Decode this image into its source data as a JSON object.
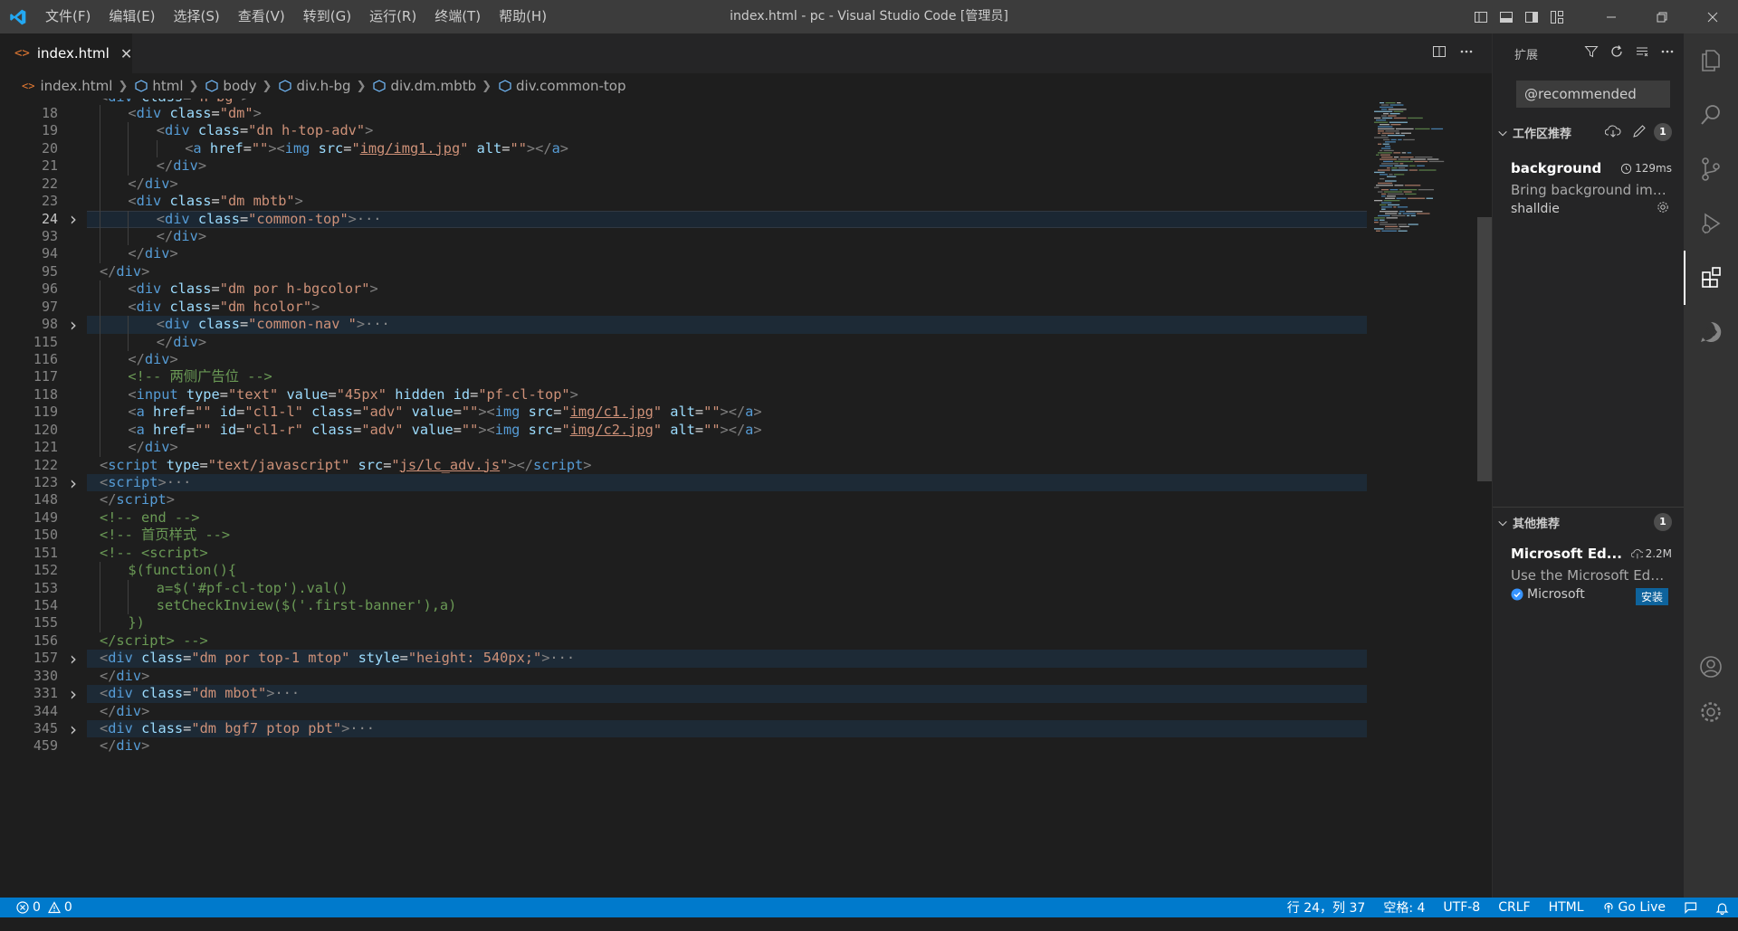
{
  "window": {
    "title": "index.html - pc - Visual Studio Code [管理员]"
  },
  "menu": [
    "文件(F)",
    "编辑(E)",
    "选择(S)",
    "查看(V)",
    "转到(G)",
    "运行(R)",
    "终端(T)",
    "帮助(H)"
  ],
  "tab": {
    "icon": "<>",
    "label": "index.html",
    "close": "✕"
  },
  "breadcrumb": [
    "index.html",
    "html",
    "body",
    "div.h-bg",
    "div.dm.mbtb",
    "div.common-top"
  ],
  "editor": {
    "partial_top_line": "<div class=\"h-bg\">",
    "cursor_line": 24,
    "lines": [
      {
        "n": "18",
        "indent": 2,
        "fold": false,
        "html": "<span class=\"t-tag\">&lt;</span><span class=\"t-name\">div</span> <span class=\"t-attr\">class</span><span class=\"t-txt\">=</span><span class=\"t-str\">\"dm\"</span><span class=\"t-tag\">&gt;</span>"
      },
      {
        "n": "19",
        "indent": 3,
        "fold": false,
        "html": "<span class=\"t-tag\">&lt;</span><span class=\"t-name\">div</span> <span class=\"t-attr\">class</span><span class=\"t-txt\">=</span><span class=\"t-str\">\"dn h-top-adv\"</span><span class=\"t-tag\">&gt;</span>"
      },
      {
        "n": "20",
        "indent": 4,
        "fold": false,
        "html": "<span class=\"t-tag\">&lt;</span><span class=\"t-name\">a</span> <span class=\"t-attr\">href</span><span class=\"t-txt\">=</span><span class=\"t-str\">\"\"</span><span class=\"t-tag\">&gt;&lt;</span><span class=\"t-name\">img</span> <span class=\"t-attr\">src</span><span class=\"t-txt\">=</span><span class=\"t-str\">\"</span><span class=\"t-link\">img/img1.jpg</span><span class=\"t-str\">\"</span> <span class=\"t-attr\">alt</span><span class=\"t-txt\">=</span><span class=\"t-str\">\"\"</span><span class=\"t-tag\">&gt;&lt;/</span><span class=\"t-name\">a</span><span class=\"t-tag\">&gt;</span>"
      },
      {
        "n": "21",
        "indent": 3,
        "fold": false,
        "html": "<span class=\"t-tag\">&lt;/</span><span class=\"t-name\">div</span><span class=\"t-tag\">&gt;</span>"
      },
      {
        "n": "22",
        "indent": 2,
        "fold": false,
        "html": "<span class=\"t-tag\">&lt;/</span><span class=\"t-name\">div</span><span class=\"t-tag\">&gt;</span>"
      },
      {
        "n": "23",
        "indent": 2,
        "fold": false,
        "html": "<span class=\"t-tag\">&lt;</span><span class=\"t-name\">div</span> <span class=\"t-attr\">class</span><span class=\"t-txt\">=</span><span class=\"t-str\">\"dm mbtb\"</span><span class=\"t-tag\">&gt;</span>"
      },
      {
        "n": "24",
        "indent": 3,
        "fold": true,
        "html": "<span class=\"t-tag\">&lt;</span><span class=\"t-name\">div</span> <span class=\"t-attr\">class</span><span class=\"t-txt\">=</span><span class=\"t-str\">\"common-top\"</span><span class=\"t-tag\">&gt;</span><span class=\"t-ell\">···</span>"
      },
      {
        "n": "93",
        "indent": 3,
        "fold": false,
        "html": "<span class=\"t-tag\">&lt;/</span><span class=\"t-name\">div</span><span class=\"t-tag\">&gt;</span>"
      },
      {
        "n": "94",
        "indent": 2,
        "fold": false,
        "html": "<span class=\"t-tag\">&lt;/</span><span class=\"t-name\">div</span><span class=\"t-tag\">&gt;</span>"
      },
      {
        "n": "95",
        "indent": 1,
        "fold": false,
        "html": "<span class=\"t-tag\">&lt;/</span><span class=\"t-name\">div</span><span class=\"t-tag\">&gt;</span>"
      },
      {
        "n": "96",
        "indent": 2,
        "fold": false,
        "html": "<span class=\"t-tag\">&lt;</span><span class=\"t-name\">div</span> <span class=\"t-attr\">class</span><span class=\"t-txt\">=</span><span class=\"t-str\">\"dm por h-bgcolor\"</span><span class=\"t-tag\">&gt;</span>"
      },
      {
        "n": "97",
        "indent": 2,
        "fold": false,
        "html": "<span class=\"t-tag\">&lt;</span><span class=\"t-name\">div</span> <span class=\"t-attr\">class</span><span class=\"t-txt\">=</span><span class=\"t-str\">\"dm hcolor\"</span><span class=\"t-tag\">&gt;</span>"
      },
      {
        "n": "98",
        "indent": 3,
        "fold": true,
        "html": "<span class=\"t-tag\">&lt;</span><span class=\"t-name\">div</span> <span class=\"t-attr\">class</span><span class=\"t-txt\">=</span><span class=\"t-str\">\"common-nav \"</span><span class=\"t-tag\">&gt;</span><span class=\"t-ell\">···</span>"
      },
      {
        "n": "115",
        "indent": 3,
        "fold": false,
        "html": "<span class=\"t-tag\">&lt;/</span><span class=\"t-name\">div</span><span class=\"t-tag\">&gt;</span>"
      },
      {
        "n": "116",
        "indent": 2,
        "fold": false,
        "html": "<span class=\"t-tag\">&lt;/</span><span class=\"t-name\">div</span><span class=\"t-tag\">&gt;</span>"
      },
      {
        "n": "117",
        "indent": 2,
        "fold": false,
        "html": "<span class=\"t-cmt\">&lt;!-- 两侧广告位 --&gt;</span>"
      },
      {
        "n": "118",
        "indent": 2,
        "fold": false,
        "html": "<span class=\"t-tag\">&lt;</span><span class=\"t-name\">input</span> <span class=\"t-attr\">type</span><span class=\"t-txt\">=</span><span class=\"t-str\">\"text\"</span> <span class=\"t-attr\">value</span><span class=\"t-txt\">=</span><span class=\"t-str\">\"45px\"</span> <span class=\"t-attr\">hidden</span> <span class=\"t-attr\">id</span><span class=\"t-txt\">=</span><span class=\"t-str\">\"pf-cl-top\"</span><span class=\"t-tag\">&gt;</span>"
      },
      {
        "n": "119",
        "indent": 2,
        "fold": false,
        "html": "<span class=\"t-tag\">&lt;</span><span class=\"t-name\">a</span> <span class=\"t-attr\">href</span><span class=\"t-txt\">=</span><span class=\"t-str\">\"\"</span> <span class=\"t-attr\">id</span><span class=\"t-txt\">=</span><span class=\"t-str\">\"cl1-l\"</span> <span class=\"t-attr\">class</span><span class=\"t-txt\">=</span><span class=\"t-str\">\"adv\"</span> <span class=\"t-attr\">value</span><span class=\"t-txt\">=</span><span class=\"t-str\">\"\"</span><span class=\"t-tag\">&gt;&lt;</span><span class=\"t-name\">img</span> <span class=\"t-attr\">src</span><span class=\"t-txt\">=</span><span class=\"t-str\">\"</span><span class=\"t-link\">img/c1.jpg</span><span class=\"t-str\">\"</span> <span class=\"t-attr\">alt</span><span class=\"t-txt\">=</span><span class=\"t-str\">\"\"</span><span class=\"t-tag\">&gt;&lt;/</span><span class=\"t-name\">a</span><span class=\"t-tag\">&gt;</span>"
      },
      {
        "n": "120",
        "indent": 2,
        "fold": false,
        "html": "<span class=\"t-tag\">&lt;</span><span class=\"t-name\">a</span> <span class=\"t-attr\">href</span><span class=\"t-txt\">=</span><span class=\"t-str\">\"\"</span> <span class=\"t-attr\">id</span><span class=\"t-txt\">=</span><span class=\"t-str\">\"cl1-r\"</span> <span class=\"t-attr\">class</span><span class=\"t-txt\">=</span><span class=\"t-str\">\"adv\"</span> <span class=\"t-attr\">value</span><span class=\"t-txt\">=</span><span class=\"t-str\">\"\"</span><span class=\"t-tag\">&gt;&lt;</span><span class=\"t-name\">img</span> <span class=\"t-attr\">src</span><span class=\"t-txt\">=</span><span class=\"t-str\">\"</span><span class=\"t-link\">img/c2.jpg</span><span class=\"t-str\">\"</span> <span class=\"t-attr\">alt</span><span class=\"t-txt\">=</span><span class=\"t-str\">\"\"</span><span class=\"t-tag\">&gt;&lt;/</span><span class=\"t-name\">a</span><span class=\"t-tag\">&gt;</span>"
      },
      {
        "n": "121",
        "indent": 2,
        "fold": false,
        "html": "<span class=\"t-tag\">&lt;/</span><span class=\"t-name\">div</span><span class=\"t-tag\">&gt;</span>"
      },
      {
        "n": "122",
        "indent": 1,
        "fold": false,
        "html": "<span class=\"t-tag\">&lt;</span><span class=\"t-name\">script</span> <span class=\"t-attr\">type</span><span class=\"t-txt\">=</span><span class=\"t-str\">\"text/javascript\"</span> <span class=\"t-attr\">src</span><span class=\"t-txt\">=</span><span class=\"t-str\">\"</span><span class=\"t-link\">js/lc_adv.js</span><span class=\"t-str\">\"</span><span class=\"t-tag\">&gt;&lt;/</span><span class=\"t-name\">script</span><span class=\"t-tag\">&gt;</span>"
      },
      {
        "n": "123",
        "indent": 1,
        "fold": true,
        "html": "<span class=\"t-tag\">&lt;</span><span class=\"t-name\">script</span><span class=\"t-tag\">&gt;</span><span class=\"t-ell\">···</span>"
      },
      {
        "n": "148",
        "indent": 1,
        "fold": false,
        "html": "<span class=\"t-tag\">&lt;/</span><span class=\"t-name\">script</span><span class=\"t-tag\">&gt;</span>"
      },
      {
        "n": "149",
        "indent": 1,
        "fold": false,
        "html": "<span class=\"t-cmt\">&lt;!-- end --&gt;</span>"
      },
      {
        "n": "150",
        "indent": 1,
        "fold": false,
        "html": "<span class=\"t-cmt\">&lt;!-- 首页样式 --&gt;</span>"
      },
      {
        "n": "151",
        "indent": 1,
        "fold": false,
        "html": "<span class=\"t-cmt\">&lt;!-- &lt;script&gt;</span>"
      },
      {
        "n": "152",
        "indent": 2,
        "fold": false,
        "html": "<span class=\"t-cmt\">$(function(){</span>"
      },
      {
        "n": "153",
        "indent": 3,
        "fold": false,
        "html": "<span class=\"t-cmt\">a=$('#pf-cl-top').val()</span>"
      },
      {
        "n": "154",
        "indent": 3,
        "fold": false,
        "html": "<span class=\"t-cmt\">setCheckInview($('.first-banner'),a)</span>"
      },
      {
        "n": "155",
        "indent": 2,
        "fold": false,
        "html": "<span class=\"t-cmt\">})</span>"
      },
      {
        "n": "156",
        "indent": 1,
        "fold": false,
        "html": "<span class=\"t-cmt\">&lt;/script&gt; --&gt;</span>"
      },
      {
        "n": "157",
        "indent": 1,
        "fold": true,
        "html": "<span class=\"t-tag\">&lt;</span><span class=\"t-name\">div</span> <span class=\"t-attr\">class</span><span class=\"t-txt\">=</span><span class=\"t-str\">\"dm por top-1 mtop\"</span> <span class=\"t-attr\">style</span><span class=\"t-txt\">=</span><span class=\"t-str\">\"height: 540px;\"</span><span class=\"t-tag\">&gt;</span><span class=\"t-ell\">···</span>"
      },
      {
        "n": "330",
        "indent": 1,
        "fold": false,
        "html": "<span class=\"t-tag\">&lt;/</span><span class=\"t-name\">div</span><span class=\"t-tag\">&gt;</span>"
      },
      {
        "n": "331",
        "indent": 1,
        "fold": true,
        "html": "<span class=\"t-tag\">&lt;</span><span class=\"t-name\">div</span> <span class=\"t-attr\">class</span><span class=\"t-txt\">=</span><span class=\"t-str\">\"dm mbot\"</span><span class=\"t-tag\">&gt;</span><span class=\"t-ell\">···</span>"
      },
      {
        "n": "344",
        "indent": 1,
        "fold": false,
        "html": "<span class=\"t-tag\">&lt;/</span><span class=\"t-name\">div</span><span class=\"t-tag\">&gt;</span>"
      },
      {
        "n": "345",
        "indent": 1,
        "fold": true,
        "html": "<span class=\"t-tag\">&lt;</span><span class=\"t-name\">div</span> <span class=\"t-attr\">class</span><span class=\"t-txt\">=</span><span class=\"t-str\">\"dm bgf7 ptop pbt\"</span><span class=\"t-tag\">&gt;</span><span class=\"t-ell\">···</span>"
      },
      {
        "n": "459",
        "indent": 1,
        "fold": false,
        "html": "<span class=\"t-tag\">&lt;/</span><span class=\"t-name\">div</span><span class=\"t-tag\">&gt;</span>"
      }
    ]
  },
  "sidebar": {
    "title": "扩展",
    "search_value": "@recommended",
    "workspace_section": {
      "title": "工作区推荐",
      "count": "1",
      "items": [
        {
          "name": "background",
          "meta": "129ms",
          "description": "Bring background ima...",
          "author": "shalldie"
        }
      ]
    },
    "other_section": {
      "title": "其他推荐",
      "count": "1",
      "items": [
        {
          "name": "Microsoft Ed...",
          "meta": "2.2M",
          "description": "Use the Microsoft Edg...",
          "author": "Microsoft",
          "install_label": "安装"
        }
      ]
    }
  },
  "statusbar": {
    "errors": "0",
    "warnings": "0",
    "position": "行 24，列 37",
    "spaces": "空格: 4",
    "encoding": "UTF-8",
    "eol": "CRLF",
    "language": "HTML",
    "golive": "Go Live"
  },
  "colors": {
    "accent": "#007acc",
    "titlebar": "#3c3c3c",
    "editor_bg": "#1e1e1e",
    "sidebar_bg": "#252526",
    "activitybar_bg": "#333333"
  }
}
